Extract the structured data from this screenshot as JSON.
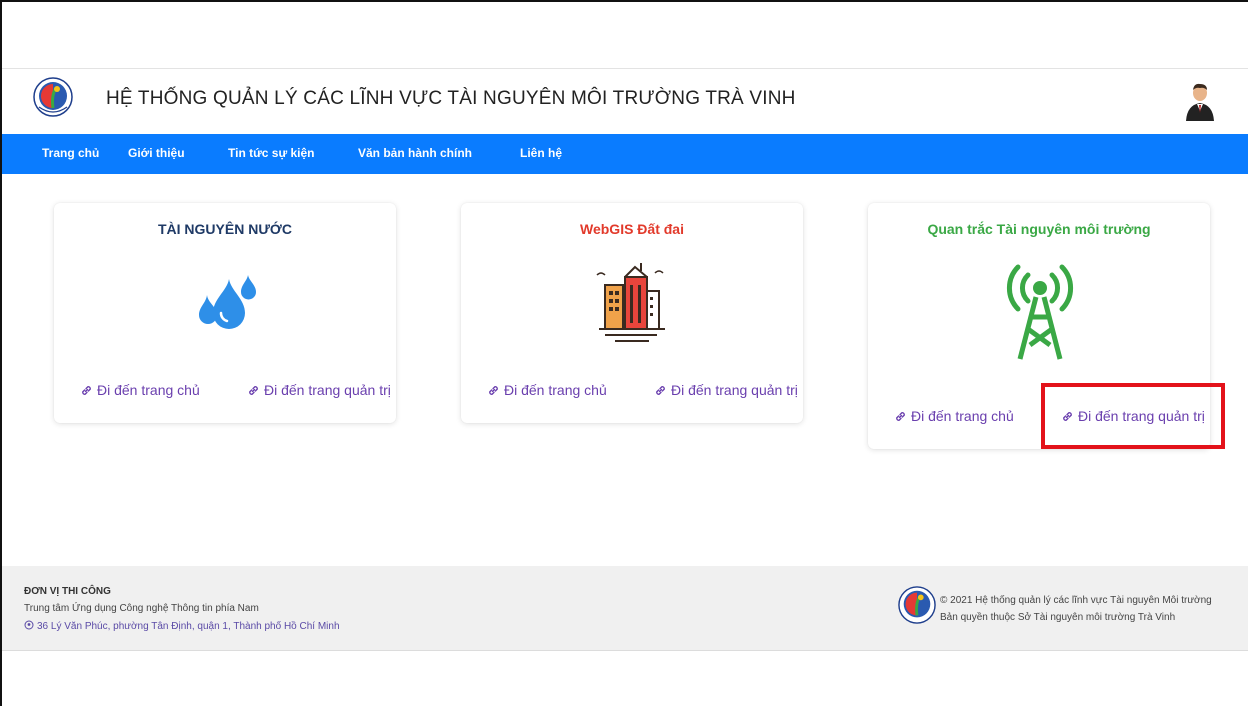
{
  "header": {
    "title": "HỆ THỐNG QUẢN LÝ CÁC LĨNH VỰC TÀI NGUYÊN MÔI TRƯỜNG TRÀ VINH"
  },
  "nav": {
    "items": [
      "Trang chủ",
      "Giới thiệu",
      "Tin tức sự kiện",
      "Văn bản hành chính",
      "Liên hệ"
    ]
  },
  "cards": [
    {
      "title": "TÀI NGUYÊN NƯỚC",
      "title_color": "#1f3a66",
      "icon": "water-drops-icon",
      "link_home": "Đi đến trang chủ",
      "link_admin": "Đi đến trang quản trị"
    },
    {
      "title": "WebGIS Đất đai",
      "title_color": "#e23a2b",
      "icon": "city-buildings-icon",
      "link_home": "Đi đến trang chủ",
      "link_admin": "Đi đến trang quản trị"
    },
    {
      "title": "Quan trắc Tài nguyên môi trường",
      "title_color": "#3aa845",
      "icon": "signal-tower-icon",
      "link_home": "Đi đến trang chủ",
      "link_admin": "Đi đến trang quản trị"
    }
  ],
  "footer": {
    "heading": "ĐƠN VỊ THI CÔNG",
    "org": "Trung tâm Ứng dụng Công nghệ Thông tin phía Nam",
    "address": "36 Lý Văn Phúc, phường Tân Định, quận 1, Thành phố Hồ Chí Minh",
    "copyright": "© 2021 Hệ thống quản lý các lĩnh vực Tài nguyên Môi trường",
    "owner": "Bản quyền thuộc Sở Tài nguyên môi trường Trà Vinh"
  },
  "colors": {
    "nav_bg": "#0a7cff",
    "link": "#6a3fae",
    "highlight": "#e3121a"
  }
}
